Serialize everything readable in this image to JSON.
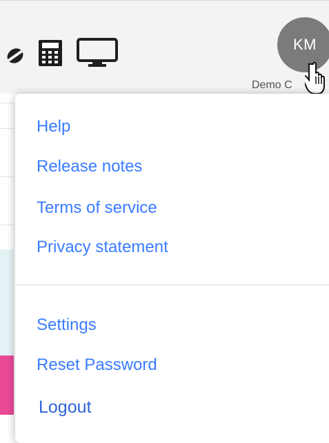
{
  "header": {
    "avatar": {
      "initials": "KM"
    },
    "org_label": "Demo C",
    "icons": [
      "tag-icon",
      "calculator-icon",
      "monitor-icon"
    ]
  },
  "menu": {
    "items": [
      {
        "label": "Help"
      },
      {
        "label": "Release notes"
      },
      {
        "label": "Terms of service"
      },
      {
        "label": "Privacy statement"
      },
      {
        "label": "Settings"
      },
      {
        "label": "Reset Password"
      },
      {
        "label": "Logout"
      }
    ]
  },
  "colors": {
    "menu_link": "#3a7cff",
    "avatar_bg": "#7b7b7b",
    "header_bg": "#f3f3f3",
    "left_pink": "#ea4b98",
    "left_cyan": "#e5f2f5"
  }
}
